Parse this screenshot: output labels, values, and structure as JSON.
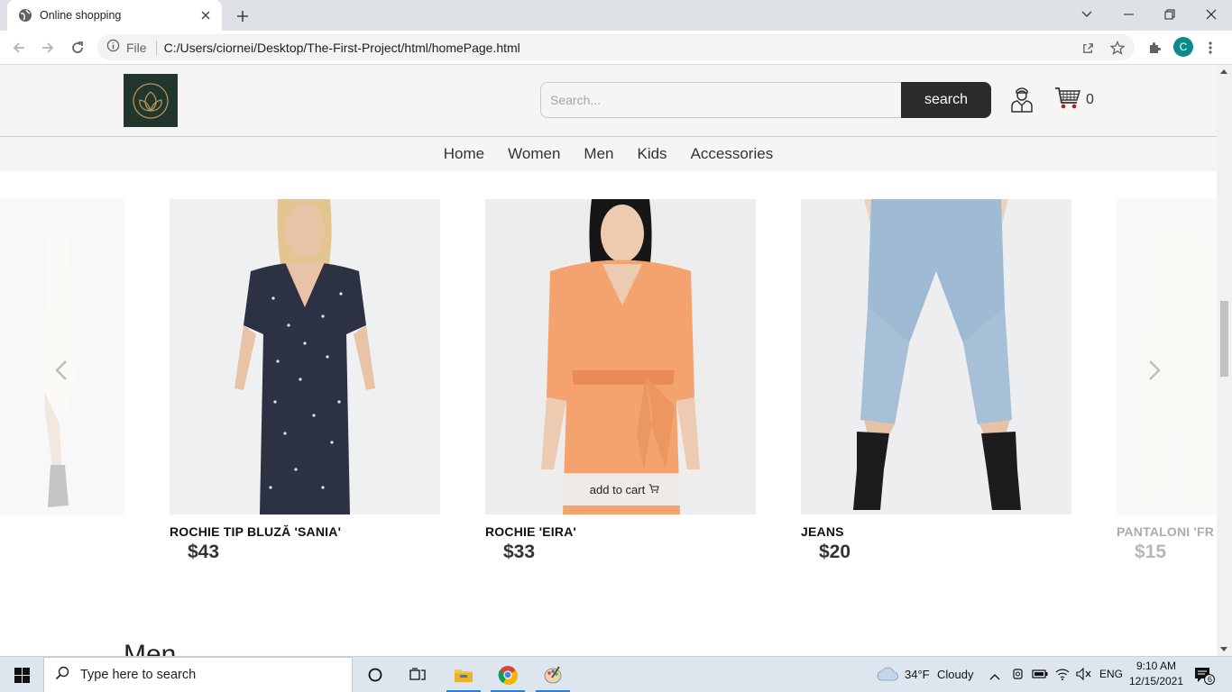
{
  "browser": {
    "tab_title": "Online shopping",
    "omnibox_file_label": "File",
    "url": "C:/Users/ciornei/Desktop/The-First-Project/html/homePage.html",
    "profile_initial": "C"
  },
  "header": {
    "search_placeholder": "Search...",
    "search_button": "search",
    "cart_count": "0"
  },
  "nav": {
    "items": [
      "Home",
      "Women",
      "Men",
      "Kids",
      "Accessories"
    ]
  },
  "carousel": {
    "products": [
      {
        "name": "",
        "price": "",
        "visibility": "partial-left",
        "image": "white slip dress with grey boots"
      },
      {
        "name": "ROCHIE TIP BLUZĂ 'SANIA'",
        "price": "$43",
        "image": "navy dotted midi dress"
      },
      {
        "name": "ROCHIE 'EIRA'",
        "price": "$33",
        "image": "peach satin dress with bow",
        "add_to_cart": "add to cart"
      },
      {
        "name": "JEANS",
        "price": "$20",
        "image": "light blue denim shorts with black boots"
      },
      {
        "name": "PANTALONI 'FR",
        "price": "$15",
        "visibility": "partial-right",
        "image": "cream trousers"
      }
    ]
  },
  "section": {
    "title": "Men"
  },
  "taskbar": {
    "search_placeholder": "Type here to search",
    "weather_temp": "34°F",
    "weather_desc": "Cloudy",
    "language": "ENG",
    "time": "9:10 AM",
    "date": "12/15/2021",
    "notification_count": "6"
  }
}
